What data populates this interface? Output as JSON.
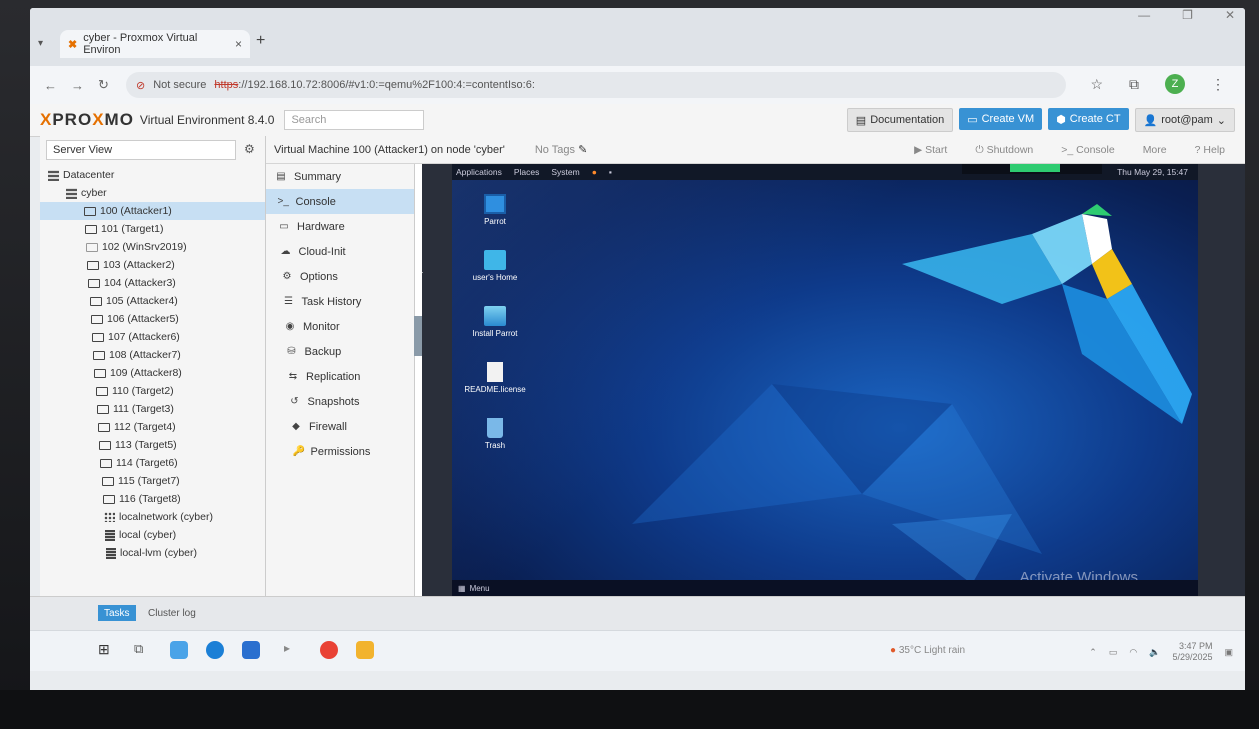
{
  "browser": {
    "tab_title": "cyber - Proxmox Virtual Environ",
    "tab_close": "×",
    "new_tab": "+",
    "security": "Not secure",
    "url_scheme": "https",
    "url_rest": "://192.168.10.72:8006/#v1:0:=qemu%2F100:4:=contentIso:6:"
  },
  "proxmox": {
    "logo_pro": "PRO",
    "logo_x": "X",
    "logo_mo": "MO",
    "logo_x2": "X",
    "subtitle": "Virtual Environment 8.4.0",
    "search_placeholder": "Search",
    "documentation": "Documentation",
    "create_vm": "Create VM",
    "create_ct": "Create CT",
    "user": "root@pam"
  },
  "tree": {
    "view": "Server View",
    "items": [
      {
        "label": "Datacenter",
        "icon": "datacenter-icon"
      },
      {
        "label": "cyber",
        "icon": "node-icon"
      },
      {
        "label": "100 (Attacker1)",
        "icon": "vm-icon",
        "selected": true
      },
      {
        "label": "101 (Target1)",
        "icon": "vm-icon"
      },
      {
        "label": "102 (WinSrv2019)",
        "icon": "vm-off-icon"
      },
      {
        "label": "103 (Attacker2)",
        "icon": "vm-icon"
      },
      {
        "label": "104 (Attacker3)",
        "icon": "vm-icon"
      },
      {
        "label": "105 (Attacker4)",
        "icon": "vm-icon"
      },
      {
        "label": "106 (Attacker5)",
        "icon": "vm-icon"
      },
      {
        "label": "107 (Attacker6)",
        "icon": "vm-icon"
      },
      {
        "label": "108 (Attacker7)",
        "icon": "vm-icon"
      },
      {
        "label": "109 (Attacker8)",
        "icon": "vm-icon"
      },
      {
        "label": "110 (Target2)",
        "icon": "vm-icon"
      },
      {
        "label": "111 (Target3)",
        "icon": "vm-icon"
      },
      {
        "label": "112 (Target4)",
        "icon": "vm-icon"
      },
      {
        "label": "113 (Target5)",
        "icon": "vm-icon"
      },
      {
        "label": "114 (Target6)",
        "icon": "vm-icon"
      },
      {
        "label": "115 (Target7)",
        "icon": "vm-icon"
      },
      {
        "label": "116 (Target8)",
        "icon": "vm-icon"
      },
      {
        "label": "localnetwork (cyber)",
        "icon": "network-icon"
      },
      {
        "label": "local (cyber)",
        "icon": "storage-icon"
      },
      {
        "label": "local-lvm (cyber)",
        "icon": "storage-icon"
      }
    ]
  },
  "content": {
    "title": "Virtual Machine 100 (Attacker1) on node 'cyber'",
    "tags": "No Tags",
    "start": "Start",
    "shutdown": "Shutdown",
    "console": "Console",
    "more": "More",
    "help": "Help",
    "menu": [
      {
        "label": "Summary",
        "icon": "summary-icon",
        "glyph": "▤"
      },
      {
        "label": "Console",
        "icon": "console-icon",
        "glyph": ">_",
        "selected": true
      },
      {
        "label": "Hardware",
        "icon": "hardware-icon",
        "glyph": "▭"
      },
      {
        "label": "Cloud-Init",
        "icon": "cloud-icon",
        "glyph": "☁"
      },
      {
        "label": "Options",
        "icon": "options-icon",
        "glyph": "⚙"
      },
      {
        "label": "Task History",
        "icon": "task-history-icon",
        "glyph": "☰"
      },
      {
        "label": "Monitor",
        "icon": "monitor-icon",
        "glyph": "◉"
      },
      {
        "label": "Backup",
        "icon": "backup-icon",
        "glyph": "⛁"
      },
      {
        "label": "Replication",
        "icon": "replication-icon",
        "glyph": "⇆"
      },
      {
        "label": "Snapshots",
        "icon": "snapshots-icon",
        "glyph": "↺"
      },
      {
        "label": "Firewall",
        "icon": "firewall-icon",
        "glyph": "◆"
      },
      {
        "label": "Permissions",
        "icon": "permissions-icon",
        "glyph": "🔑"
      }
    ]
  },
  "vm": {
    "applications": "Applications",
    "places": "Places",
    "system": "System",
    "clock": "Thu May 29, 15:47",
    "icons": [
      "Parrot",
      "user's Home",
      "Install Parrot",
      "README.license",
      "Trash"
    ],
    "menu": "Menu",
    "activate": "Activate Windows"
  },
  "logbar": {
    "tasks": "Tasks",
    "cluster_log": "Cluster log"
  },
  "taskbar": {
    "weather": "35°C  Light rain",
    "time": "3:47 PM",
    "date": "5/29/2025"
  }
}
